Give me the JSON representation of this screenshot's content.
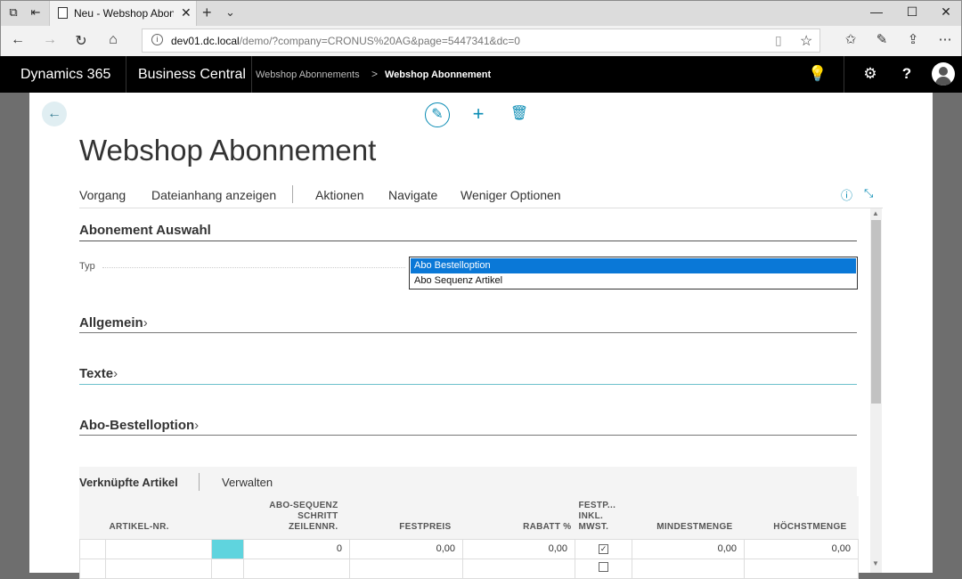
{
  "browser": {
    "tab_title": "Neu - Webshop Abonne",
    "url_host": "dev01.dc.local",
    "url_path": "/demo/?company=CRONUS%20AG&page=5447341&dc=0"
  },
  "header": {
    "brand": "Dynamics 365",
    "product": "Business Central",
    "crumb1": "Webshop Abonnements",
    "crumb_sep": ">",
    "crumb2": "Webshop Abonnement"
  },
  "page": {
    "title": "Webshop Abonnement"
  },
  "menu": {
    "items": [
      "Vorgang",
      "Dateianhang anzeigen",
      "Aktionen",
      "Navigate",
      "Weniger Optionen"
    ]
  },
  "sections": {
    "auswahl": "Abonement Auswahl",
    "allgemein": "Allgemein",
    "texte": "Texte",
    "bestelloption": "Abo-Bestelloption"
  },
  "field": {
    "typ_label": "Typ",
    "options": [
      "Abo Bestelloption",
      "Abo Sequenz Artikel"
    ],
    "selected": "Abo Bestelloption"
  },
  "subpage": {
    "title": "Verknüpfte Artikel",
    "action": "Verwalten",
    "columns": [
      "ARTIKEL-NR.",
      "ABO-SEQUENZ SCHRITT ZEILENNR.",
      "FESTPREIS",
      "RABATT %",
      "FESTP... INKL. MWST.",
      "MINDESTMENGE",
      "HÖCHSTMENGE"
    ],
    "rows": [
      {
        "artikel": "",
        "zeilennr": "0",
        "festpreis": "0,00",
        "rabatt": "0,00",
        "inkl": "☑",
        "min": "0,00",
        "max": "0,00"
      },
      {
        "artikel": "",
        "zeilennr": "",
        "festpreis": "",
        "rabatt": "",
        "inkl": "☐",
        "min": "",
        "max": ""
      }
    ]
  },
  "colors": {
    "accent": "#0a8cb4",
    "selection": "#0a78d7",
    "cyan": "#5fd4de"
  }
}
